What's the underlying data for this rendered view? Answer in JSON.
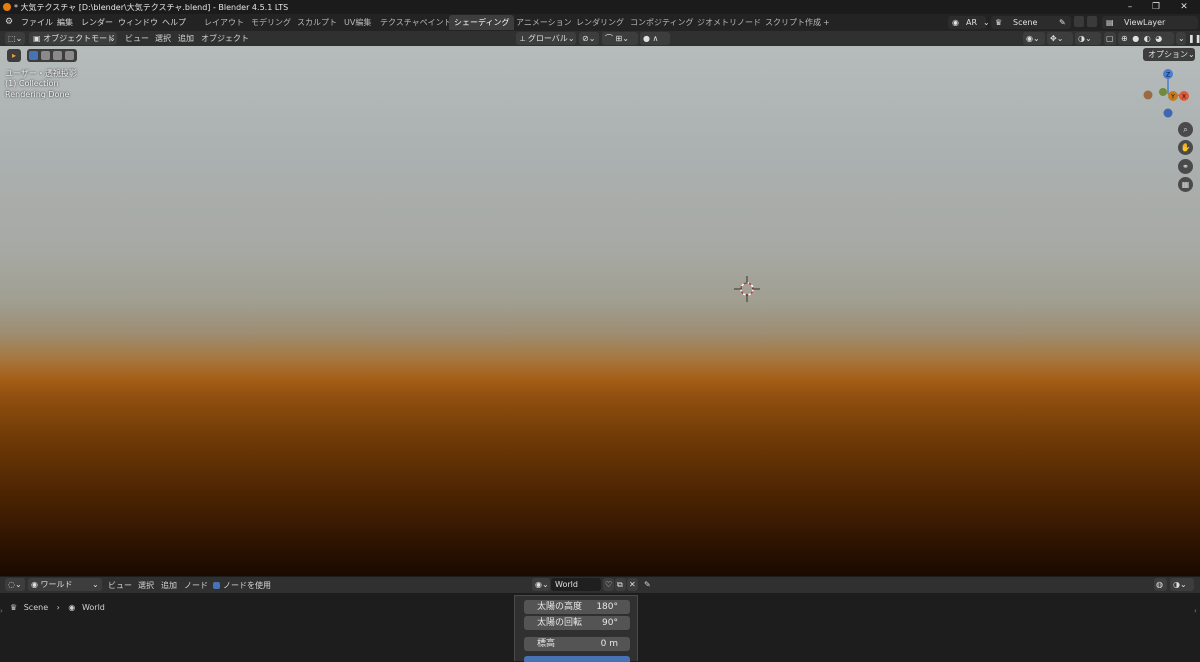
{
  "window": {
    "title": "* 大気テクスチャ [D:\\blender\\大気テクスチャ.blend] - Blender 4.5.1 LTS"
  },
  "menu": {
    "items": [
      "ファイル",
      "編集",
      "レンダー",
      "ウィンドウ",
      "ヘルプ"
    ]
  },
  "workspaces": {
    "tabs": [
      "レイアウト",
      "モデリング",
      "スカルプト",
      "UV編集",
      "テクスチャペイント",
      "シェーディング",
      "アニメーション",
      "レンダリング",
      "コンポジティング",
      "ジオメトリノード",
      "スクリプト作成"
    ],
    "active": "シェーディング",
    "add_label": "+"
  },
  "topright": {
    "ar_label": "AR",
    "scene_name": "Scene",
    "view_layer": "ViewLayer"
  },
  "viewport_header": {
    "mode": "オブジェクトモード",
    "menus": [
      "ビュー",
      "選択",
      "追加",
      "オブジェクト"
    ],
    "transform": "グローバル",
    "options_label": "オプション"
  },
  "viewport": {
    "overlay_view": "ユーザー・透視投影",
    "overlay_collection": "(1) Collection",
    "overlay_status": "Rendering Done",
    "gizmo": {
      "x": "X",
      "y": "Y",
      "z": "Z"
    }
  },
  "shader_header": {
    "type": "ワールド",
    "menus": [
      "ビュー",
      "選択",
      "追加",
      "ノード"
    ],
    "use_nodes_label": "ノードを使用",
    "world_name": "World"
  },
  "breadcrumb": {
    "scene": "Scene",
    "world": "World"
  },
  "node": {
    "rows": [
      {
        "label": "太陽の高度",
        "value": "180°"
      },
      {
        "label": "太陽の回転",
        "value": "90°"
      },
      {
        "label": "標高",
        "value": "0 m"
      }
    ]
  },
  "colors": {
    "accent": "#4772b3",
    "active_tab": "#3d3d3d",
    "logo": "#e87d0d",
    "axis_x": "#e05a3a",
    "axis_y": "#89b83a",
    "axis_z": "#4a7cd6"
  }
}
